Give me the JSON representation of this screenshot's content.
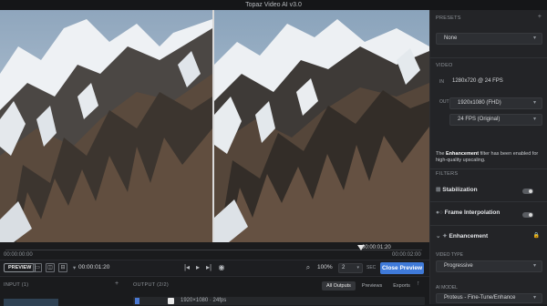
{
  "app": {
    "title": "Topaz Video AI  v3.0"
  },
  "timeline": {
    "time_start": "00:00:00:00",
    "time_current": "00:00:01:20",
    "time_end": "00:00:02:00"
  },
  "controls": {
    "preview_tag": "PREVIEW",
    "current_time": "00:00:01:20",
    "zoom_value": "100%",
    "preview_count": "2",
    "preview_unit": "SEC",
    "close_preview_label": "Close Preview"
  },
  "bottom": {
    "input_label": "INPUT (1)",
    "output_label": "OUTPUT (2/2)",
    "tabs": [
      {
        "label": "All Outputs",
        "active": true
      },
      {
        "label": "Previews",
        "active": false
      },
      {
        "label": "Exports",
        "active": false
      }
    ],
    "output_row_text": "1920×1080 · 24fps"
  },
  "right_panel": {
    "presets_header": "PRESETS",
    "preset_value": "None",
    "video_header": "VIDEO",
    "input_label": "IN",
    "input_spec": "1280x720 @ 24 FPS",
    "output_label": "OUT",
    "resolution_value": "1920x1080 (FHD)",
    "fps_value": "24 FPS (Original)",
    "note_bold": "Enhancement",
    "note_pre": "The ",
    "note_post": " filter has been enabled for high-quality upscaling.",
    "filters_header": "FILTERS",
    "filters": [
      {
        "label": "Stabilization",
        "enabled": false
      },
      {
        "label": "Frame Interpolation",
        "enabled": false
      },
      {
        "label": "Enhancement",
        "enabled": true
      }
    ],
    "video_type_label": "VIDEO TYPE",
    "video_type_value": "Progressive",
    "ai_model_label": "AI MODEL",
    "ai_model_value": "Proteus - Fine-Tune/Enhance"
  },
  "colors": {
    "accent": "#3f7ad9",
    "panel_bg": "#232427",
    "app_bg": "#1b1c1e"
  }
}
